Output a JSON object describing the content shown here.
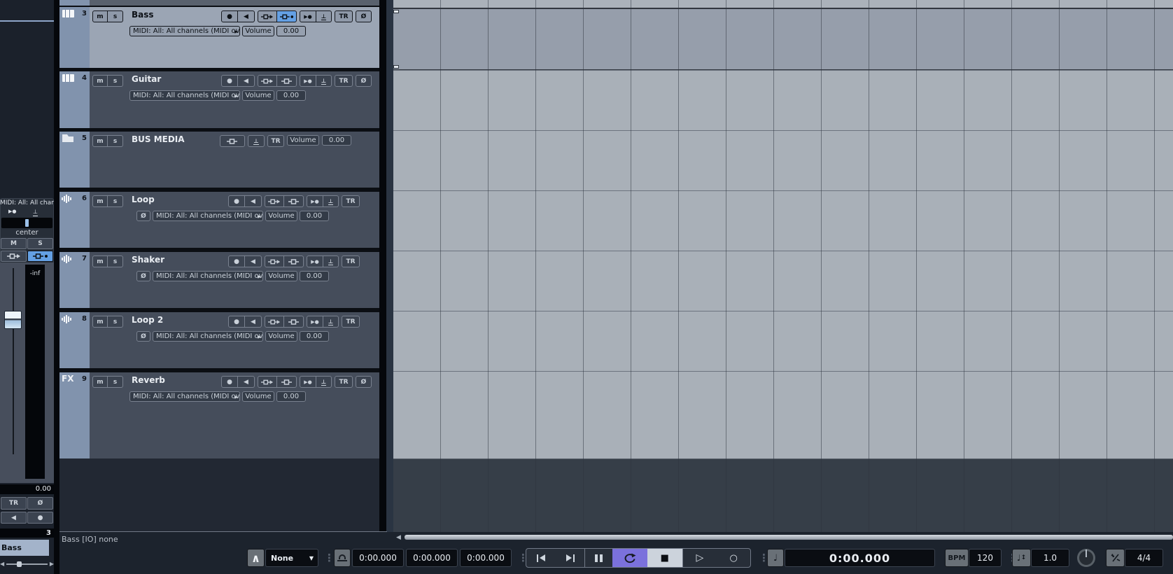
{
  "colors": {
    "accent_blue": "#64a0e4",
    "cycle_purple": "#7b71dc",
    "track_strip": "#8193ad",
    "selected_track_bg": "#9ba5b4",
    "lane_bg": "#a9b0b8"
  },
  "icons": {
    "monitor": "◀",
    "record": "●",
    "record_circle": "○",
    "play": "▷",
    "stop": "■",
    "dropdown_arrow": "▼",
    "arp_up": "∧",
    "quarter_note": "♩",
    "updown": "↕",
    "timebase": "⊥",
    "play_record": "▶●",
    "truncate_arrow": "▶",
    "dots": "⋮",
    "scroll_left": "◀",
    "slider_left": "◀",
    "slider_right": "▶"
  },
  "labels": {
    "mute": "m",
    "solo": "s",
    "tr": "TR",
    "phase": "Ø",
    "volume": "Volume"
  },
  "inspector": {
    "section_title": "MIDI: All: All channe",
    "pan_value": "center",
    "mute": "M",
    "solo": "S",
    "fader_value": "-inf",
    "level_value": "0.00",
    "tr": "TR",
    "phase": "Ø",
    "track_number": "3",
    "track_name": "Bass"
  },
  "tracks": [
    {
      "number": "3",
      "name": "Bass",
      "routing": "MIDI: All: All channels (MIDI over",
      "volume": "0.00"
    },
    {
      "number": "4",
      "name": "Guitar",
      "routing": "MIDI: All: All channels (MIDI over",
      "volume": "0.00"
    },
    {
      "number": "5",
      "name": "BUS MEDIA",
      "volume": "0.00"
    },
    {
      "number": "6",
      "name": "Loop",
      "routing": "MIDI: All: All channels (MIDI over",
      "volume": "0.00"
    },
    {
      "number": "7",
      "name": "Shaker",
      "routing": "MIDI: All: All channels (MIDI over",
      "volume": "0.00"
    },
    {
      "number": "8",
      "name": "Loop 2",
      "routing": "MIDI: All: All channels (MIDI over",
      "volume": "0.00"
    },
    {
      "number": "9",
      "name": "Reverb",
      "type_label": "FX",
      "routing": "MIDI: All: All channels (MIDI over",
      "volume": "0.00"
    }
  ],
  "status_bar": {
    "info": "Bass [IO] none"
  },
  "transport": {
    "insert_mode": "None",
    "times": [
      "0:00.000",
      "0:00.000",
      "0:00.000"
    ],
    "primary_time": "0:00.000",
    "tempo_label": "BPM",
    "tempo": "120",
    "speed": "1.0",
    "time_signature": "4/4"
  }
}
